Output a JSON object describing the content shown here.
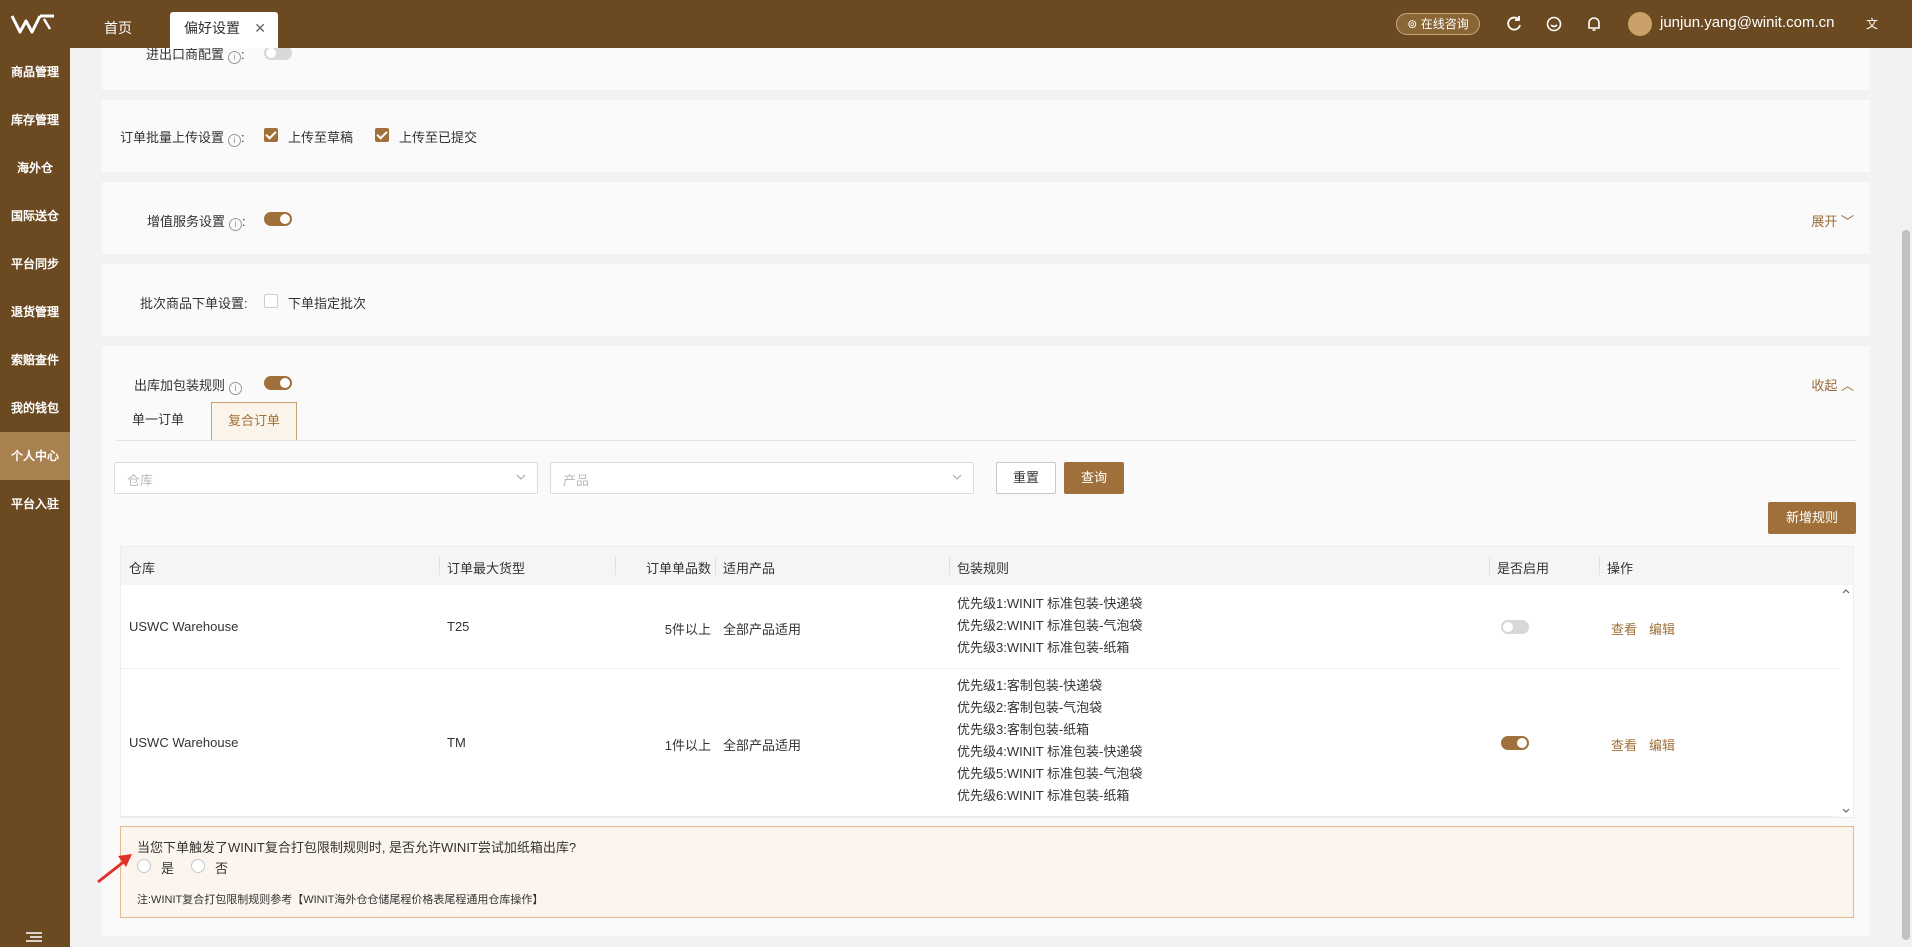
{
  "header": {
    "tabs": [
      {
        "label": "首页"
      },
      {
        "label": "偏好设置"
      }
    ],
    "consult_label": "在线咨询",
    "user_email": "junjun.yang@winit.com.cn",
    "accent_color": "#6b4a22"
  },
  "sidebar": {
    "items": [
      {
        "label": "商品管理"
      },
      {
        "label": "库存管理"
      },
      {
        "label": "海外仓"
      },
      {
        "label": "国际送仓"
      },
      {
        "label": "平台同步"
      },
      {
        "label": "退货管理"
      },
      {
        "label": "索赔查件"
      },
      {
        "label": "我的钱包"
      },
      {
        "label": "个人中心",
        "active": true
      },
      {
        "label": "平台入驻"
      }
    ]
  },
  "settings": {
    "import_export": {
      "label": "进出口商配置",
      "colon": ":",
      "enabled": false
    },
    "batch_upload": {
      "label": "订单批量上传设置",
      "colon": ":",
      "options": [
        {
          "label": "上传至草稿",
          "checked": true
        },
        {
          "label": "上传至已提交",
          "checked": true
        }
      ]
    },
    "value_added": {
      "label": "增值服务设置",
      "colon": ":",
      "enabled": true,
      "expand_label": "展开"
    },
    "batch_goods": {
      "label": "批次商品下单设置:",
      "option_label": "下单指定批次",
      "checked": false
    },
    "packaging": {
      "label": "出库加包装规则",
      "enabled": true,
      "collapse_label": "收起",
      "tabs": [
        {
          "label": "单一订单"
        },
        {
          "label": "复合订单",
          "active": true
        }
      ],
      "filters": {
        "warehouse_placeholder": "仓库",
        "product_placeholder": "产品",
        "reset_label": "重置",
        "query_label": "查询",
        "add_rule_label": "新增规则"
      },
      "table": {
        "columns": [
          "仓库",
          "订单最大货型",
          "订单单品数",
          "适用产品",
          "包装规则",
          "是否启用",
          "操作"
        ],
        "rows": [
          {
            "warehouse": "USWC Warehouse",
            "max_type": "T25",
            "count": "5件以上",
            "product": "全部产品适用",
            "rules": [
              "优先级1:WINIT 标准包装-快递袋",
              "优先级2:WINIT 标准包装-气泡袋",
              "优先级3:WINIT 标准包装-纸箱"
            ],
            "enabled": false,
            "view_label": "查看",
            "edit_label": "编辑"
          },
          {
            "warehouse": "USWC Warehouse",
            "max_type": "TM",
            "count": "1件以上",
            "product": "全部产品适用",
            "rules": [
              "优先级1:客制包装-快递袋",
              "优先级2:客制包装-气泡袋",
              "优先级3:客制包装-纸箱",
              "优先级4:WINIT 标准包装-快递袋",
              "优先级5:WINIT 标准包装-气泡袋",
              "优先级6:WINIT 标准包装-纸箱"
            ],
            "enabled": true,
            "view_label": "查看",
            "edit_label": "编辑"
          }
        ]
      },
      "notice": {
        "question": "当您下单触发了WINIT复合打包限制规则时, 是否允许WINIT尝试加纸箱出库?",
        "yes_label": "是",
        "no_label": "否",
        "note": "注:WINIT复合打包限制规则参考【WINIT海外仓仓储尾程价格表尾程通用仓库操作】"
      }
    }
  }
}
